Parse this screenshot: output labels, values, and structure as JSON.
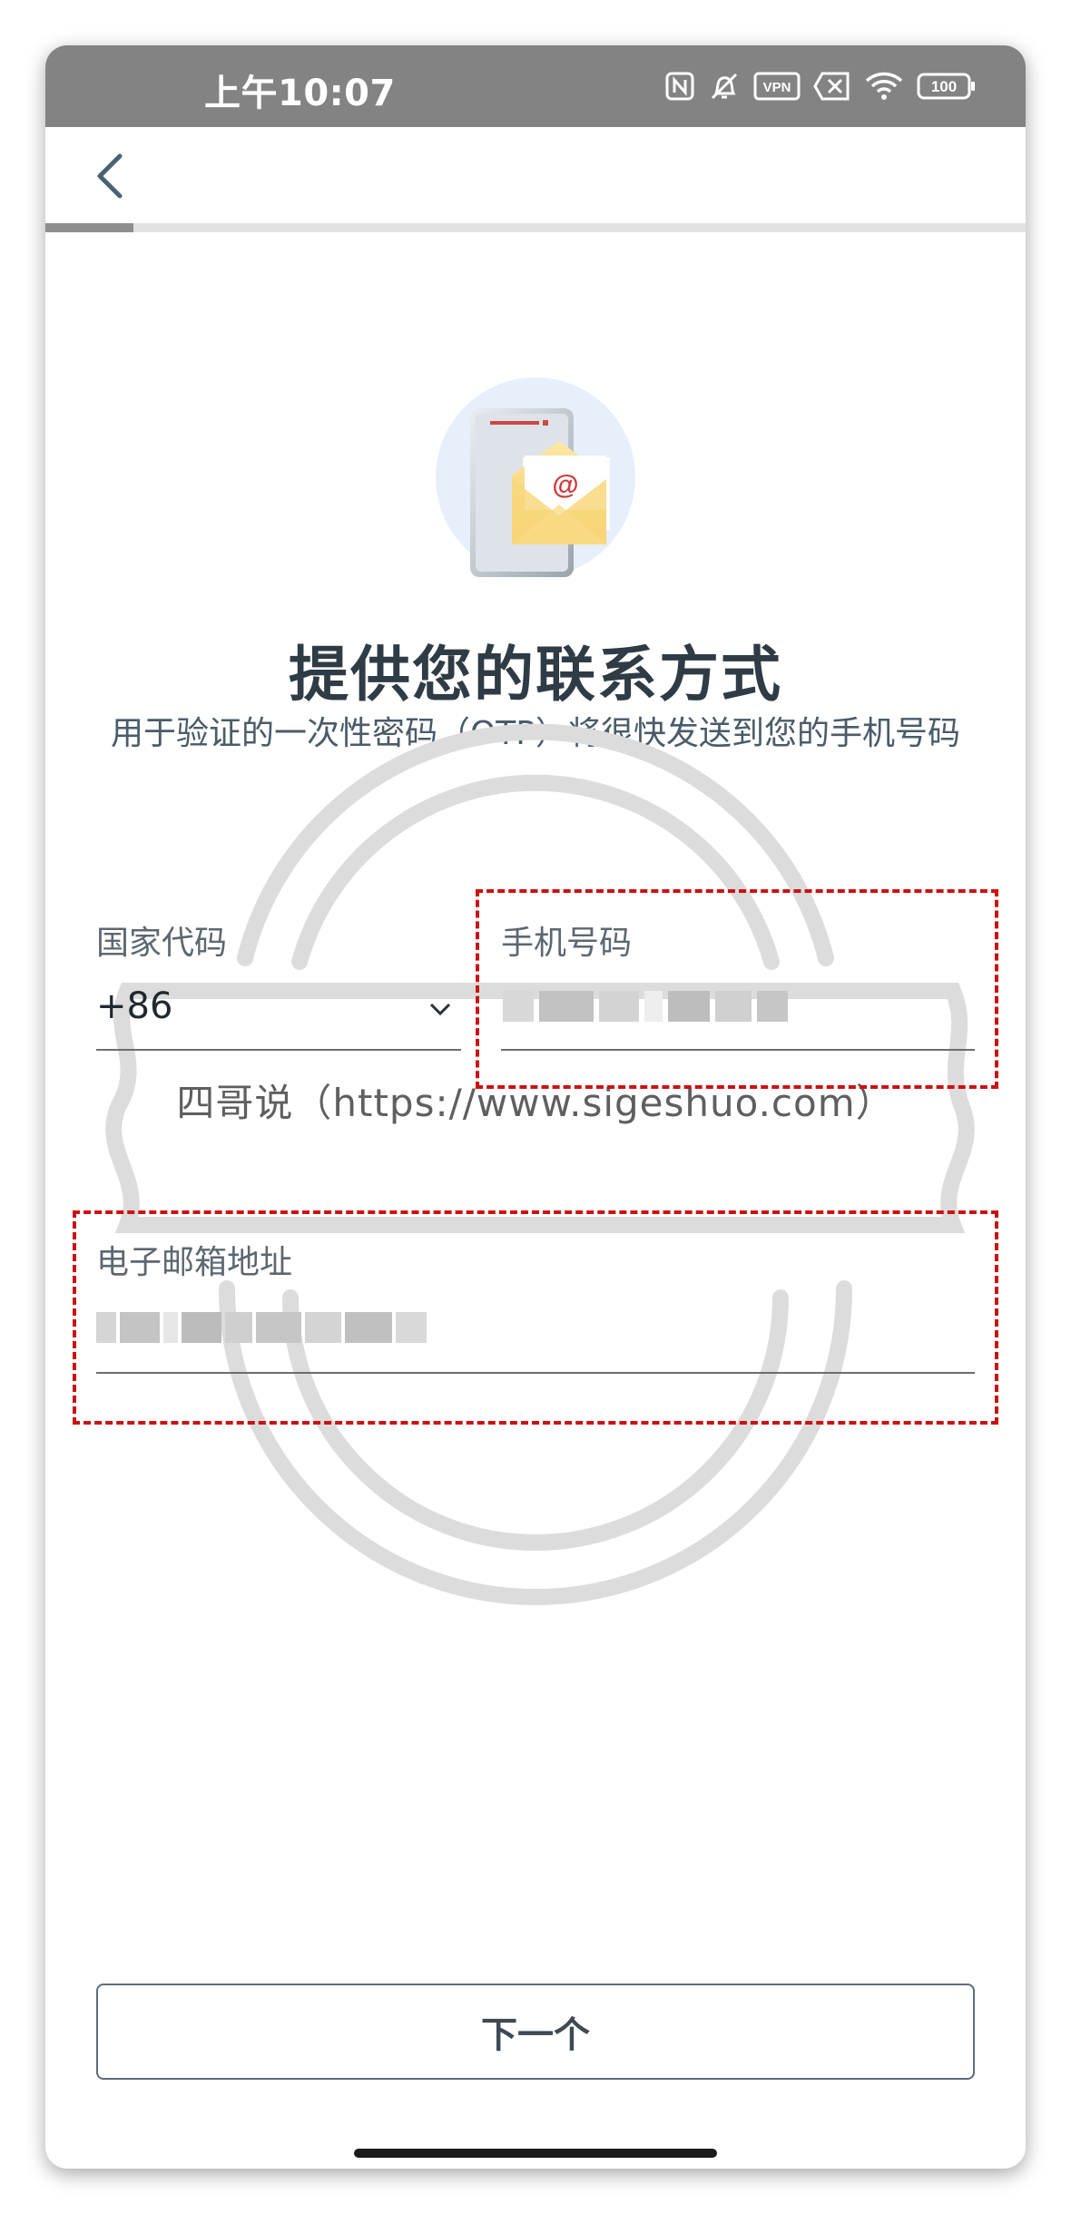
{
  "status_bar": {
    "time": "上午10:07",
    "vpn_label": "VPN",
    "battery_level": "100",
    "icons": [
      "nfc-icon",
      "bell-off-icon",
      "vpn-icon",
      "sim-off-icon",
      "wifi-icon",
      "battery-icon"
    ]
  },
  "header": {
    "back_icon": "chevron-left-icon"
  },
  "progress": {
    "value": 0.09
  },
  "main": {
    "title": "提供您的联系方式",
    "subtitle": "用于验证的一次性密码（OTP）将很快发送到您的手机号码"
  },
  "form": {
    "country_code": {
      "label": "国家代码",
      "value": "+86"
    },
    "phone": {
      "label": "手机号码"
    },
    "email": {
      "label": "电子邮箱地址"
    }
  },
  "watermark": {
    "text": "四哥说（https://www.sigeshuo.com）"
  },
  "footer": {
    "next_label": "下一个"
  },
  "colors": {
    "status_bar": "#838383",
    "title": "#2f3b45",
    "highlight": "#cc1111",
    "button_border": "#5b6d7c"
  }
}
